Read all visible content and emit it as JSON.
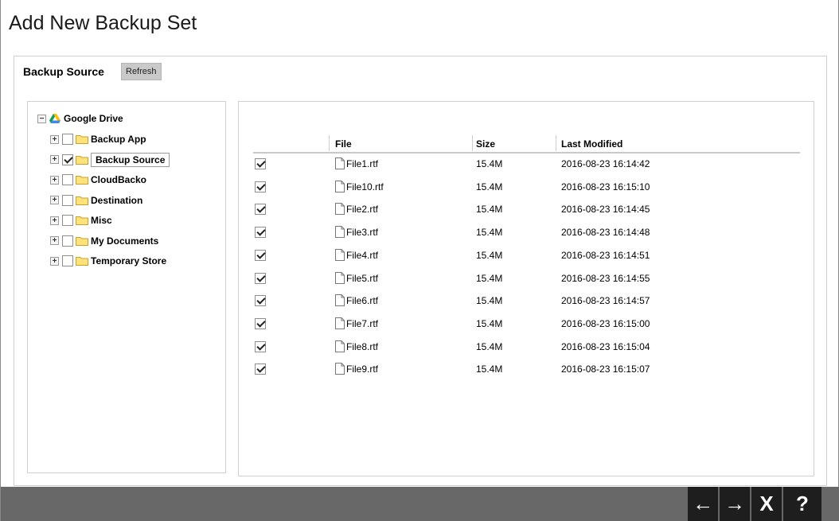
{
  "page": {
    "title": "Add New Backup Set"
  },
  "section": {
    "label": "Backup Source",
    "refresh_label": "Refresh"
  },
  "tree": {
    "root": {
      "label": "Google Drive",
      "toggle": "−"
    },
    "items": [
      {
        "label": "Backup App",
        "toggle": "+",
        "checked": false,
        "selected": false
      },
      {
        "label": "Backup Source",
        "toggle": "+",
        "checked": true,
        "selected": true
      },
      {
        "label": "CloudBacko",
        "toggle": "+",
        "checked": false,
        "selected": false
      },
      {
        "label": "Destination",
        "toggle": "+",
        "checked": false,
        "selected": false
      },
      {
        "label": "Misc",
        "toggle": "+",
        "checked": false,
        "selected": false
      },
      {
        "label": "My Documents",
        "toggle": "+",
        "checked": false,
        "selected": false
      },
      {
        "label": "Temporary Store",
        "toggle": "+",
        "checked": false,
        "selected": false
      }
    ]
  },
  "files": {
    "columns": {
      "file": "File",
      "size": "Size",
      "modified": "Last Modified"
    },
    "rows": [
      {
        "name": "File1.rtf",
        "size": "15.4M",
        "modified": "2016-08-23 16:14:42",
        "checked": true
      },
      {
        "name": "File10.rtf",
        "size": "15.4M",
        "modified": "2016-08-23 16:15:10",
        "checked": true
      },
      {
        "name": "File2.rtf",
        "size": "15.4M",
        "modified": "2016-08-23 16:14:45",
        "checked": true
      },
      {
        "name": "File3.rtf",
        "size": "15.4M",
        "modified": "2016-08-23 16:14:48",
        "checked": true
      },
      {
        "name": "File4.rtf",
        "size": "15.4M",
        "modified": "2016-08-23 16:14:51",
        "checked": true
      },
      {
        "name": "File5.rtf",
        "size": "15.4M",
        "modified": "2016-08-23 16:14:55",
        "checked": true
      },
      {
        "name": "File6.rtf",
        "size": "15.4M",
        "modified": "2016-08-23 16:14:57",
        "checked": true
      },
      {
        "name": "File7.rtf",
        "size": "15.4M",
        "modified": "2016-08-23 16:15:00",
        "checked": true
      },
      {
        "name": "File8.rtf",
        "size": "15.4M",
        "modified": "2016-08-23 16:15:04",
        "checked": true
      },
      {
        "name": "File9.rtf",
        "size": "15.4M",
        "modified": "2016-08-23 16:15:07",
        "checked": true
      }
    ]
  },
  "nav": {
    "previous_glyph": "←",
    "next_glyph": "→",
    "cancel_glyph": "X",
    "help_glyph": "?"
  },
  "icons": {
    "tree_toggle": "plus-minus-box",
    "folder": "folder-icon",
    "file": "document-icon",
    "drive": "google-drive-icon"
  },
  "colors": {
    "bottom_bar": "#686868",
    "nav_button": "#1e1e1e",
    "folder_fill": "#ffe27a",
    "folder_stroke": "#c9a22a"
  }
}
